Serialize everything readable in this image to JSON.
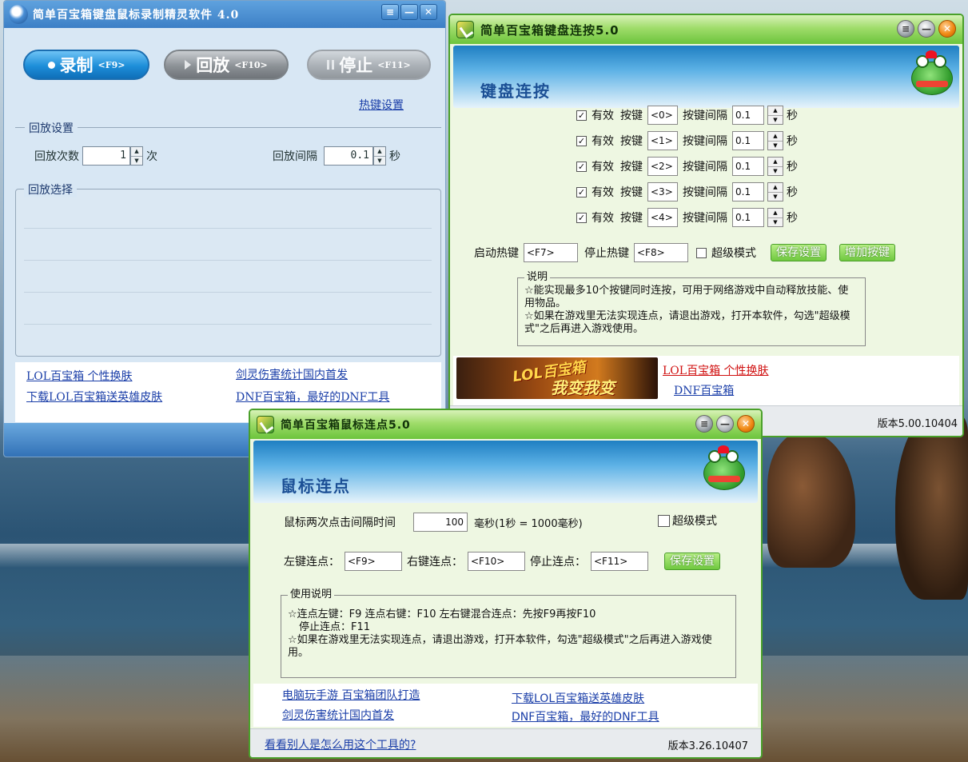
{
  "recorder": {
    "title": "简单百宝箱键盘鼠标录制精灵软件  4.0",
    "title_buttons": [
      "≡",
      "—",
      "✕"
    ],
    "record": {
      "label": "录制",
      "key": "<F9>"
    },
    "play": {
      "label": "回放",
      "key": "<F10>"
    },
    "stop": {
      "label": "停止",
      "key": "<F11>"
    },
    "hotkey_link": "热键设置",
    "playback_settings": {
      "legend": "回放设置",
      "count_label": "回放次数",
      "count_value": "1",
      "count_unit": "次",
      "interval_label": "回放间隔",
      "interval_value": "0.1",
      "interval_unit": "秒"
    },
    "playback_select": {
      "legend": "回放选择"
    },
    "links": [
      "LOL百宝箱 个性换肤",
      "剑灵伤害统计国内首发",
      "下载LOL百宝箱送英雄皮肤",
      "DNF百宝箱，最好的DNF工具"
    ]
  },
  "keyboard": {
    "title": "简单百宝箱键盘连按5.0",
    "banner": "键盘连按",
    "rows": [
      {
        "checked": true,
        "valid_label": "有效",
        "key_label": "按键",
        "key": "<0>",
        "interval_label": "按键间隔",
        "interval": "0.1",
        "unit": "秒"
      },
      {
        "checked": true,
        "valid_label": "有效",
        "key_label": "按键",
        "key": "<1>",
        "interval_label": "按键间隔",
        "interval": "0.1",
        "unit": "秒"
      },
      {
        "checked": true,
        "valid_label": "有效",
        "key_label": "按键",
        "key": "<2>",
        "interval_label": "按键间隔",
        "interval": "0.1",
        "unit": "秒"
      },
      {
        "checked": true,
        "valid_label": "有效",
        "key_label": "按键",
        "key": "<3>",
        "interval_label": "按键间隔",
        "interval": "0.1",
        "unit": "秒"
      },
      {
        "checked": true,
        "valid_label": "有效",
        "key_label": "按键",
        "key": "<4>",
        "interval_label": "按键间隔",
        "interval": "0.1",
        "unit": "秒"
      }
    ],
    "start_hotkey_label": "启动热键",
    "start_hotkey": "<F7>",
    "stop_hotkey_label": "停止热键",
    "stop_hotkey": "<F8>",
    "super_mode_label": "超级模式",
    "save_button": "保存设置",
    "add_button": "增加按键",
    "notes": {
      "legend": "说明",
      "line1": "☆能实现最多10个按键同时连按，可用于网络游戏中自动释放技能、使用物品。",
      "line2": "☆如果在游戏里无法实现连点，请退出游戏，打开本软件，勾选\"超级模式\"之后再进入游戏使用。"
    },
    "ad_text_a": "LOL百宝箱",
    "ad_text_b": "我变我变",
    "links": [
      "LOL百宝箱 个性换肤",
      "DNF百宝箱"
    ],
    "version": "版本5.00.10404"
  },
  "mouse": {
    "title": "简单百宝箱鼠标连点5.0",
    "banner": "鼠标连点",
    "interval_label": "鼠标两次点击间隔时间",
    "interval_value": "100",
    "interval_unit": "毫秒(1秒 = 1000毫秒)",
    "super_mode_label": "超级模式",
    "left_label": "左键连点：",
    "left_key": "<F9>",
    "right_label": "右键连点：",
    "right_key": "<F10>",
    "stop_label": "停止连点：",
    "stop_key": "<F11>",
    "save_button": "保存设置",
    "usage": {
      "legend": "使用说明",
      "line1": "☆连点左键：F9   连点右键：F10   左右键混合连点：先按F9再按F10",
      "line2": "停止连点：F11",
      "line3": "☆如果在游戏里无法实现连点，请退出游戏，打开本软件，勾选\"超级模式\"之后再进入游戏使用。"
    },
    "links": [
      "电脑玩手游 百宝箱团队打造",
      "下载LOL百宝箱送英雄皮肤",
      "剑灵伤害统计国内首发",
      "DNF百宝箱，最好的DNF工具"
    ],
    "footer_link": "看看别人是怎么用这个工具的?",
    "version": "版本3.26.10407"
  }
}
